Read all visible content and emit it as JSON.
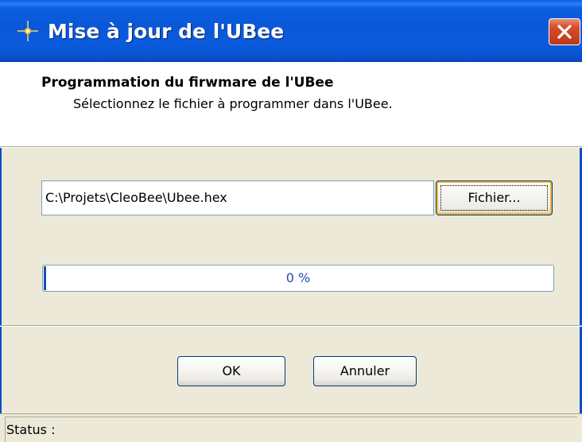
{
  "window": {
    "title": "Mise à jour de l'UBee"
  },
  "header": {
    "title": "Programmation du firwmare de l'UBee",
    "subtitle": "Sélectionnez le fichier à programmer dans l'UBee."
  },
  "file": {
    "path": "C:\\Projets\\CleoBee\\Ubee.hex",
    "browse_label": "Fichier..."
  },
  "progress": {
    "value_percent": 0,
    "label": "0 %"
  },
  "buttons": {
    "ok_label": "OK",
    "cancel_label": "Annuler"
  },
  "status": {
    "text": "Status :"
  },
  "icons": {
    "app": "sparkle-icon",
    "close": "close-icon"
  },
  "colors": {
    "titlebar": "#0A58D8",
    "close_button": "#C9421E",
    "window_body": "#ECE9D8",
    "progress_text": "#1C4FAE"
  }
}
